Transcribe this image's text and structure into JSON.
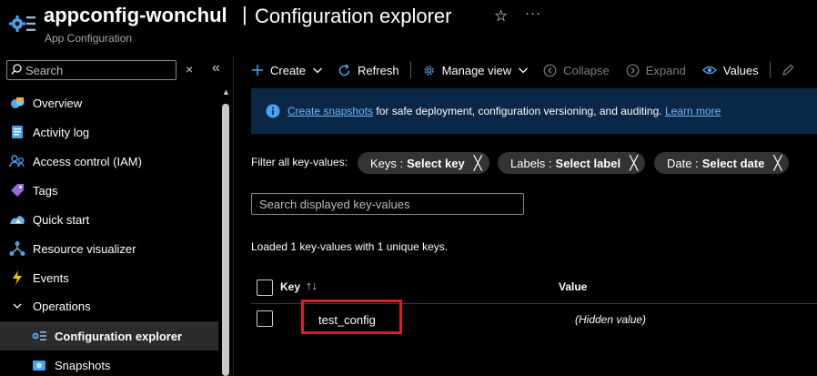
{
  "header": {
    "resource_name": "appconfig-wonchul",
    "separator": "|",
    "blade_title": "Configuration explorer",
    "subtitle": "App Configuration",
    "favorite_glyph": "☆",
    "more_glyph": "···"
  },
  "sidebar": {
    "search_placeholder": "Search",
    "clear_glyph": "×",
    "collapse_glyph": "«",
    "items": [
      {
        "label": "Overview",
        "icon": "overview-icon"
      },
      {
        "label": "Activity log",
        "icon": "activity-log-icon"
      },
      {
        "label": "Access control (IAM)",
        "icon": "access-control-icon"
      },
      {
        "label": "Tags",
        "icon": "tag-icon"
      },
      {
        "label": "Quick start",
        "icon": "quick-start-icon"
      },
      {
        "label": "Resource visualizer",
        "icon": "resource-visualizer-icon"
      },
      {
        "label": "Events",
        "icon": "events-icon"
      },
      {
        "label": "Operations",
        "icon": "chevron-down-icon"
      },
      {
        "label": "Configuration explorer",
        "icon": "configuration-explorer-icon"
      },
      {
        "label": "Snapshots",
        "icon": "snapshots-icon"
      }
    ]
  },
  "toolbar": {
    "create": "Create",
    "refresh": "Refresh",
    "manage_view": "Manage view",
    "collapse": "Collapse",
    "expand": "Expand",
    "values": "Values"
  },
  "banner": {
    "link1": "Create snapshots",
    "text": " for safe deployment, configuration versioning, and auditing. ",
    "link2": "Learn more"
  },
  "filters": {
    "label": "Filter all key-values:",
    "keys_prefix": "Keys :",
    "keys_value": "Select key",
    "labels_prefix": "Labels :",
    "labels_value": "Select label",
    "date_prefix": "Date :",
    "date_value": "Select date",
    "remove_glyph": "╳"
  },
  "search": {
    "placeholder": "Search displayed key-values"
  },
  "status": {
    "loaded_text": "Loaded 1 key-values with 1 unique keys."
  },
  "table": {
    "col_key": "Key",
    "sort_glyph": "↑↓",
    "col_value": "Value",
    "rows": [
      {
        "key": "test_config",
        "value": "(Hidden value)"
      }
    ]
  },
  "colors": {
    "background": "#000000",
    "banner_bg": "#0b2748",
    "accent": "#4aa3f0",
    "link": "#6cb8f6",
    "highlight": "#e01b24"
  }
}
